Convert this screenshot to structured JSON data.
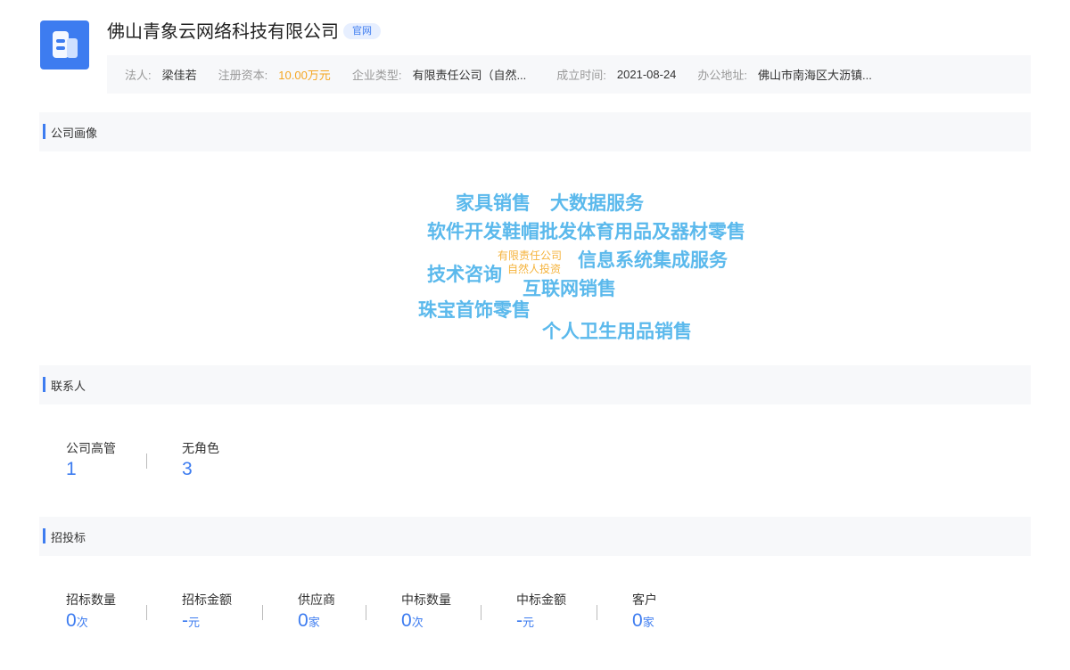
{
  "header": {
    "company_name": "佛山青象云网络科技有限公司",
    "site_badge": "官网",
    "logo_icon": "building-icon",
    "info": {
      "legal_person_label": "法人:",
      "legal_person_value": "梁佳若",
      "capital_label": "注册资本:",
      "capital_value": "10.00万元",
      "type_label": "企业类型:",
      "type_value": "有限责任公司（自然...",
      "established_label": "成立时间:",
      "established_value": "2021-08-24",
      "address_label": "办公地址:",
      "address_value": "佛山市南海区大沥镇..."
    }
  },
  "portrait": {
    "title": "公司画像",
    "words": [
      "家具销售",
      "大数据服务",
      "软件开发鞋帽批发体育用品及器材零售",
      "有限责任公司",
      "自然人投资",
      "信息系统集成服务",
      "技术咨询",
      "互联网销售",
      "珠宝首饰零售",
      "个人卫生用品销售"
    ]
  },
  "contacts": {
    "title": "联系人",
    "stats": [
      {
        "label": "公司高管",
        "value": "1"
      },
      {
        "label": "无角色",
        "value": "3"
      }
    ]
  },
  "bidding": {
    "title": "招投标",
    "stats": [
      {
        "label": "招标数量",
        "value": "0",
        "unit": "次"
      },
      {
        "label": "招标金额",
        "value": "-",
        "unit": "元"
      },
      {
        "label": "供应商",
        "value": "0",
        "unit": "家"
      },
      {
        "label": "中标数量",
        "value": "0",
        "unit": "次"
      },
      {
        "label": "中标金额",
        "value": "-",
        "unit": "元"
      },
      {
        "label": "客户",
        "value": "0",
        "unit": "家"
      }
    ]
  },
  "colors": {
    "accent": "#3d7cf0",
    "tag_blue": "#5bb9ec",
    "tag_orange": "#f5b33c",
    "capital_orange": "#f5a623"
  }
}
